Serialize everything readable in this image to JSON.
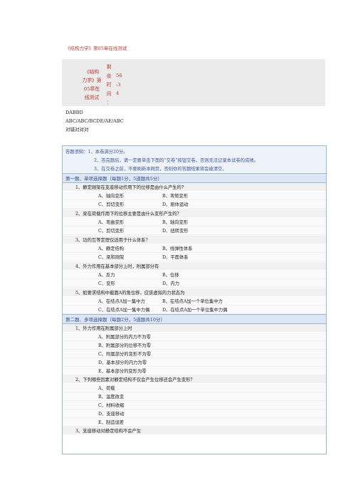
{
  "page_title": "《结构力学》第05章在线测试",
  "info": {
    "title_lines": [
      "《结构",
      "力学》第",
      "05章在",
      "线测试"
    ],
    "timer_label_chars": [
      "剩",
      "余",
      "时",
      "间",
      "："
    ],
    "timer_values": [
      "56",
      ":3",
      "4"
    ]
  },
  "answers": [
    "DABBD",
    "ABC/ABC/BCDE/AE/ABC",
    "对错对对对"
  ],
  "notice": [
    "答题须知：1、本卷满分20分。",
    "2、答完题后，请一定要单击下面的“交卷”按钮交卷，否则无法记录本试卷的成绩。",
    "3、在交卷之前，不要刷新本网页，否则你的答题结果将会被清空。"
  ],
  "section1": {
    "title": "第一题、单项选择题（每题1分，5道题共5分）",
    "questions": [
      {
        "q": "1、静定刚架在支座移动作用下的位移是由什么产生的？",
        "options": [
          "A、轴向变形",
          "B、弯矩变形",
          "C、剪切变形",
          "D、刚体运动"
        ]
      },
      {
        "q": "2、梁在荷载作用下的位移主要是由什么变形产生的？",
        "options": [
          "A、弯曲变形",
          "B、轴向变形",
          "C、剪切变形",
          "D、扭转变形"
        ]
      },
      {
        "q": "3、功的互等定理仅适用于什么体系？",
        "options": [
          "A、静定结构",
          "B、线弹性体系",
          "C、梁和刚架",
          "D、平面体系"
        ]
      },
      {
        "q": "4、外力作用在基本部分上时，附属部分有",
        "options": [
          "A、反力",
          "B、位移",
          "C、变形",
          "D、内力"
        ]
      },
      {
        "q": "5、如要求结构中截面A的角位移，应该虚拟的力状态为",
        "options": [
          "A、在结点A加一集中力",
          "B、在结点A加一个单位集中力",
          "C、在结点A加一集中力偶",
          "D、在结点A加一个单位集中力偶"
        ]
      }
    ]
  },
  "section2": {
    "title": "第二题、多项选择题（每题2分，5道题共10分）",
    "questions": [
      {
        "q": "1、外力作用在附属部分上时",
        "options": [
          "A、附属部分的内力不为零",
          "B、附属部分的位移不为零",
          "C、附属部分的变形不为零",
          "D、基本部分的内力为零",
          "E、基本部分的变形为零"
        ]
      },
      {
        "q": "2、下列哪些因素对静定结构不仅会产生位移还会产生变形？",
        "options": [
          "A、荷载",
          "B、温度改变",
          "C、材料收缩",
          "D、支座移动",
          "E、制造误差"
        ]
      },
      {
        "q": "3、支座移动对静定结构不会产生",
        "options": []
      }
    ]
  }
}
